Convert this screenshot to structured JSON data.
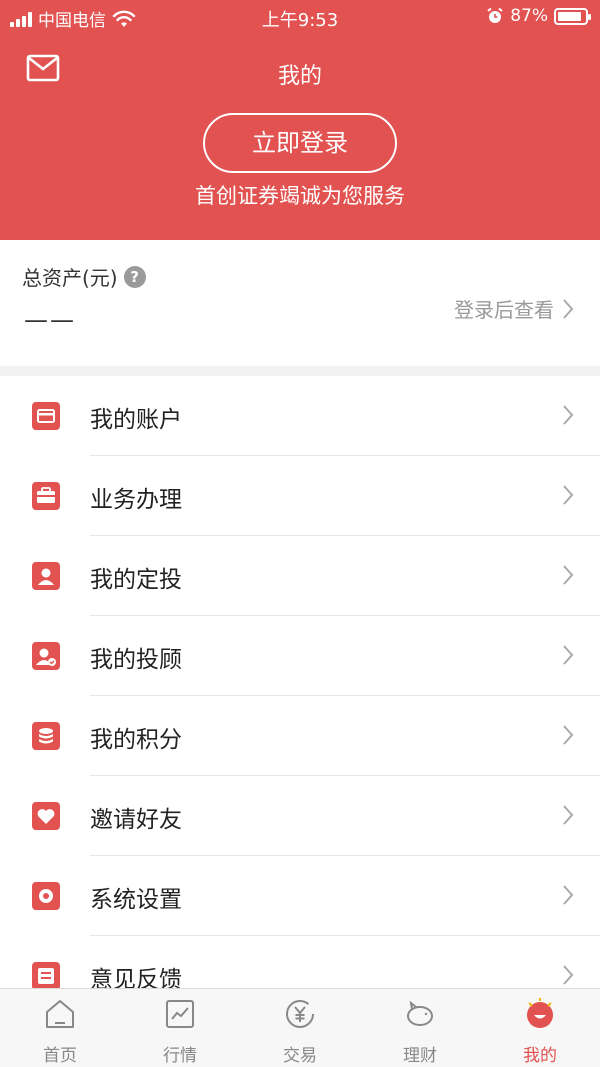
{
  "status_bar": {
    "carrier": "中国电信",
    "time": "上午9:53",
    "battery": "87%",
    "battery_level": 0.87
  },
  "header": {
    "title": "我的",
    "login_label": "立即登录",
    "slogan": "首创证券竭诚为您服务"
  },
  "assets": {
    "label": "总资产(元)",
    "help": "?",
    "value": "——",
    "view_label": "登录后查看"
  },
  "menu": {
    "items": [
      {
        "label": "我的账户",
        "icon": "card-icon"
      },
      {
        "label": "业务办理",
        "icon": "briefcase-icon"
      },
      {
        "label": "我的定投",
        "icon": "person-icon"
      },
      {
        "label": "我的投顾",
        "icon": "advisor-icon"
      },
      {
        "label": "我的积分",
        "icon": "coins-icon"
      },
      {
        "label": "邀请好友",
        "icon": "heart-icon"
      },
      {
        "label": "系统设置",
        "icon": "settings-icon"
      },
      {
        "label": "意见反馈",
        "icon": "feedback-icon"
      }
    ]
  },
  "tabbar": {
    "tabs": [
      {
        "label": "首页",
        "icon": "home-icon"
      },
      {
        "label": "行情",
        "icon": "chart-icon"
      },
      {
        "label": "交易",
        "icon": "yuan-icon"
      },
      {
        "label": "理财",
        "icon": "piggy-icon"
      },
      {
        "label": "我的",
        "icon": "me-icon",
        "active": true
      }
    ]
  },
  "colors": {
    "brand": "#e15250",
    "text": "#222222",
    "muted": "#999999"
  }
}
